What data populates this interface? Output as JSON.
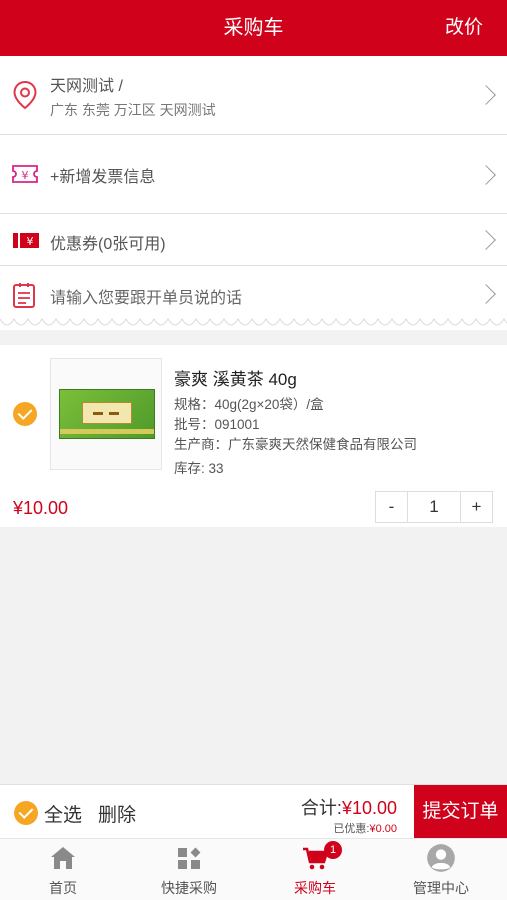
{
  "header": {
    "title": "采购车",
    "action_label": "改价"
  },
  "address": {
    "name_line": "天网测试 /",
    "region_line": "广东 东莞 万江区 天网测试"
  },
  "invoice": {
    "label": "+新增发票信息"
  },
  "coupon": {
    "label": "优惠券(0张可用)"
  },
  "message": {
    "placeholder": "请输入您要跟开单员说的话"
  },
  "product": {
    "name": "豪爽 溪黄茶 40g",
    "spec": "规格：40g(2g×20袋）/盒",
    "batch": "批号：091001",
    "manufacturer": "生产商：广东豪爽天然保健食品有限公司",
    "stock": "库存: 33",
    "price": "¥10.00",
    "quantity": "1",
    "minus": "-",
    "plus": "+"
  },
  "footer": {
    "select_all": "全选",
    "delete": "删除",
    "total_label": "合计:",
    "total_amount": "¥10.00",
    "discount_label": "已优惠:",
    "discount_amount": "¥0.00",
    "submit": "提交订单"
  },
  "tabs": [
    {
      "label": "首页",
      "icon": "home-icon"
    },
    {
      "label": "快捷采购",
      "icon": "grid-icon"
    },
    {
      "label": "采购车",
      "icon": "cart-icon",
      "badge": "1"
    },
    {
      "label": "管理中心",
      "icon": "user-icon"
    }
  ],
  "colors": {
    "brand": "#d0021b",
    "check": "#f5a623"
  }
}
